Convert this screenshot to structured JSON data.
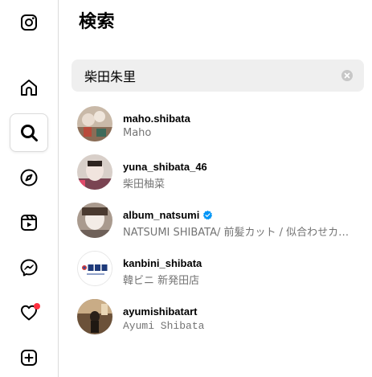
{
  "sidebar": {
    "items": [
      {
        "name": "instagram-logo-icon"
      },
      {
        "name": "home-icon"
      },
      {
        "name": "search-icon",
        "active": true
      },
      {
        "name": "explore-compass-icon"
      },
      {
        "name": "reels-icon"
      },
      {
        "name": "messenger-icon"
      },
      {
        "name": "notifications-heart-icon",
        "badge": true
      },
      {
        "name": "create-plus-icon"
      }
    ],
    "badge_color": "#ff3040"
  },
  "panel": {
    "title": "検索",
    "search": {
      "value": "柴田朱里"
    }
  },
  "results": [
    {
      "username": "maho.shibata",
      "subtitle": "Maho",
      "verified": false
    },
    {
      "username": "yuna_shibata_46",
      "subtitle": "柴田柚菜",
      "verified": false
    },
    {
      "username": "album_natsumi",
      "subtitle": "NATSUMI SHIBATA/ 前髪カット / 似合わせカット",
      "verified": true
    },
    {
      "username": "kanbini_shibata",
      "subtitle": "韓ビニ 新発田店",
      "verified": false
    },
    {
      "username": "ayumishibatart",
      "subtitle": "Ayumi Shibata",
      "verified": false
    }
  ],
  "colors": {
    "verified_badge": "#0095f6",
    "search_bg": "#efefef",
    "subtitle_text": "#737373",
    "border": "#dbdbdb"
  }
}
